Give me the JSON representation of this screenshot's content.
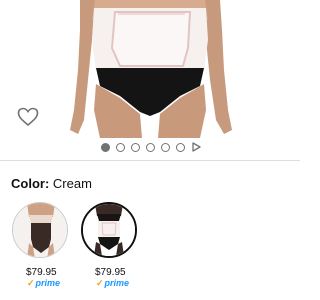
{
  "product_image": {
    "alt": "Woman wearing cream postpartum belly wrap"
  },
  "gallery": {
    "dot_count": 6,
    "active_index": 0,
    "video_icon": "play-icon"
  },
  "wishlist": {
    "icon": "heart-icon"
  },
  "color": {
    "label": "Color:",
    "selected": "Cream"
  },
  "swatches": [
    {
      "name": "Black",
      "price": "$79.95",
      "prime": "prime",
      "selected": false
    },
    {
      "name": "Cream",
      "price": "$79.95",
      "prime": "prime",
      "selected": true
    }
  ],
  "colors": {
    "prime_blue": "#1a98ff",
    "prime_check": "#f0a21a",
    "dot_gray": "#6f7373"
  }
}
